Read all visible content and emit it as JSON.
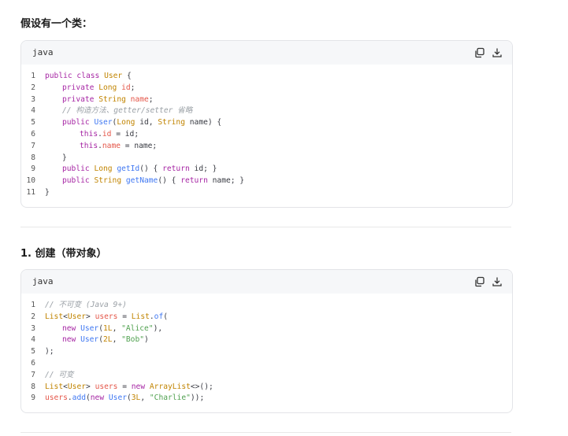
{
  "intro_heading": "假设有一个类：",
  "section1_heading": "1. 创建（带对象）",
  "code_block_1": {
    "language": "java",
    "lines": [
      {
        "n": "1",
        "indent": 0,
        "tokens": [
          [
            "kw",
            "public class "
          ],
          [
            "ty",
            "User"
          ],
          [
            "pl",
            " {"
          ]
        ]
      },
      {
        "n": "2",
        "indent": 1,
        "tokens": [
          [
            "kw",
            "private "
          ],
          [
            "ty",
            "Long "
          ],
          [
            "fld",
            "id"
          ],
          [
            "pl",
            ";"
          ]
        ]
      },
      {
        "n": "3",
        "indent": 1,
        "tokens": [
          [
            "kw",
            "private "
          ],
          [
            "ty",
            "String "
          ],
          [
            "fld",
            "name"
          ],
          [
            "pl",
            ";"
          ]
        ]
      },
      {
        "n": "4",
        "indent": 1,
        "tokens": [
          [
            "com",
            "// 构造方法、getter/setter 省略"
          ]
        ]
      },
      {
        "n": "5",
        "indent": 1,
        "tokens": [
          [
            "kw",
            "public "
          ],
          [
            "fn",
            "User"
          ],
          [
            "pl",
            "("
          ],
          [
            "ty",
            "Long "
          ],
          [
            "pl",
            "id, "
          ],
          [
            "ty",
            "String "
          ],
          [
            "pl",
            "name) {"
          ]
        ]
      },
      {
        "n": "6",
        "indent": 2,
        "tokens": [
          [
            "kw",
            "this"
          ],
          [
            "pl",
            "."
          ],
          [
            "fld",
            "id"
          ],
          [
            "pl",
            " = id;"
          ]
        ]
      },
      {
        "n": "7",
        "indent": 2,
        "tokens": [
          [
            "kw",
            "this"
          ],
          [
            "pl",
            "."
          ],
          [
            "fld",
            "name"
          ],
          [
            "pl",
            " = name;"
          ]
        ]
      },
      {
        "n": "8",
        "indent": 1,
        "tokens": [
          [
            "pl",
            "}"
          ]
        ]
      },
      {
        "n": "9",
        "indent": 1,
        "tokens": [
          [
            "kw",
            "public "
          ],
          [
            "ty",
            "Long "
          ],
          [
            "fn",
            "getId"
          ],
          [
            "pl",
            "() { "
          ],
          [
            "kw",
            "return "
          ],
          [
            "pl",
            "id; }"
          ]
        ]
      },
      {
        "n": "10",
        "indent": 1,
        "tokens": [
          [
            "kw",
            "public "
          ],
          [
            "ty",
            "String "
          ],
          [
            "fn",
            "getName"
          ],
          [
            "pl",
            "() { "
          ],
          [
            "kw",
            "return "
          ],
          [
            "pl",
            "name; }"
          ]
        ]
      },
      {
        "n": "11",
        "indent": 0,
        "tokens": [
          [
            "pl",
            "}"
          ]
        ]
      }
    ]
  },
  "code_block_2": {
    "language": "java",
    "lines": [
      {
        "n": "1",
        "indent": 0,
        "tokens": [
          [
            "com",
            "// 不可变 (Java 9+)"
          ]
        ]
      },
      {
        "n": "2",
        "indent": 0,
        "tokens": [
          [
            "ty",
            "List"
          ],
          [
            "pl",
            "<"
          ],
          [
            "ty",
            "User"
          ],
          [
            "pl",
            "> "
          ],
          [
            "fld",
            "users"
          ],
          [
            "pl",
            " = "
          ],
          [
            "ty",
            "List"
          ],
          [
            "pl",
            "."
          ],
          [
            "fn",
            "of"
          ],
          [
            "pl",
            "("
          ]
        ]
      },
      {
        "n": "3",
        "indent": 1,
        "tokens": [
          [
            "kw",
            "new "
          ],
          [
            "fn",
            "User"
          ],
          [
            "pl",
            "("
          ],
          [
            "num",
            "1L"
          ],
          [
            "pl",
            ", "
          ],
          [
            "str",
            "\"Alice\""
          ],
          [
            "pl",
            "),"
          ]
        ]
      },
      {
        "n": "4",
        "indent": 1,
        "tokens": [
          [
            "kw",
            "new "
          ],
          [
            "fn",
            "User"
          ],
          [
            "pl",
            "("
          ],
          [
            "num",
            "2L"
          ],
          [
            "pl",
            ", "
          ],
          [
            "str",
            "\"Bob\""
          ],
          [
            "pl",
            ")"
          ]
        ]
      },
      {
        "n": "5",
        "indent": 0,
        "tokens": [
          [
            "pl",
            ");"
          ]
        ]
      },
      {
        "n": "6",
        "indent": 0,
        "tokens": []
      },
      {
        "n": "7",
        "indent": 0,
        "tokens": [
          [
            "com",
            "// 可变"
          ]
        ]
      },
      {
        "n": "8",
        "indent": 0,
        "tokens": [
          [
            "ty",
            "List"
          ],
          [
            "pl",
            "<"
          ],
          [
            "ty",
            "User"
          ],
          [
            "pl",
            "> "
          ],
          [
            "fld",
            "users"
          ],
          [
            "pl",
            " = "
          ],
          [
            "kw",
            "new "
          ],
          [
            "ty",
            "ArrayList"
          ],
          [
            "pl",
            "<>();"
          ]
        ]
      },
      {
        "n": "9",
        "indent": 0,
        "tokens": [
          [
            "fld",
            "users"
          ],
          [
            "pl",
            "."
          ],
          [
            "fn",
            "add"
          ],
          [
            "pl",
            "("
          ],
          [
            "kw",
            "new "
          ],
          [
            "fn",
            "User"
          ],
          [
            "pl",
            "("
          ],
          [
            "num",
            "3L"
          ],
          [
            "pl",
            ", "
          ],
          [
            "str",
            "\"Charlie\""
          ],
          [
            "pl",
            "));"
          ]
        ]
      }
    ]
  },
  "icons": {
    "copy": "copy-icon",
    "download": "download-icon"
  }
}
